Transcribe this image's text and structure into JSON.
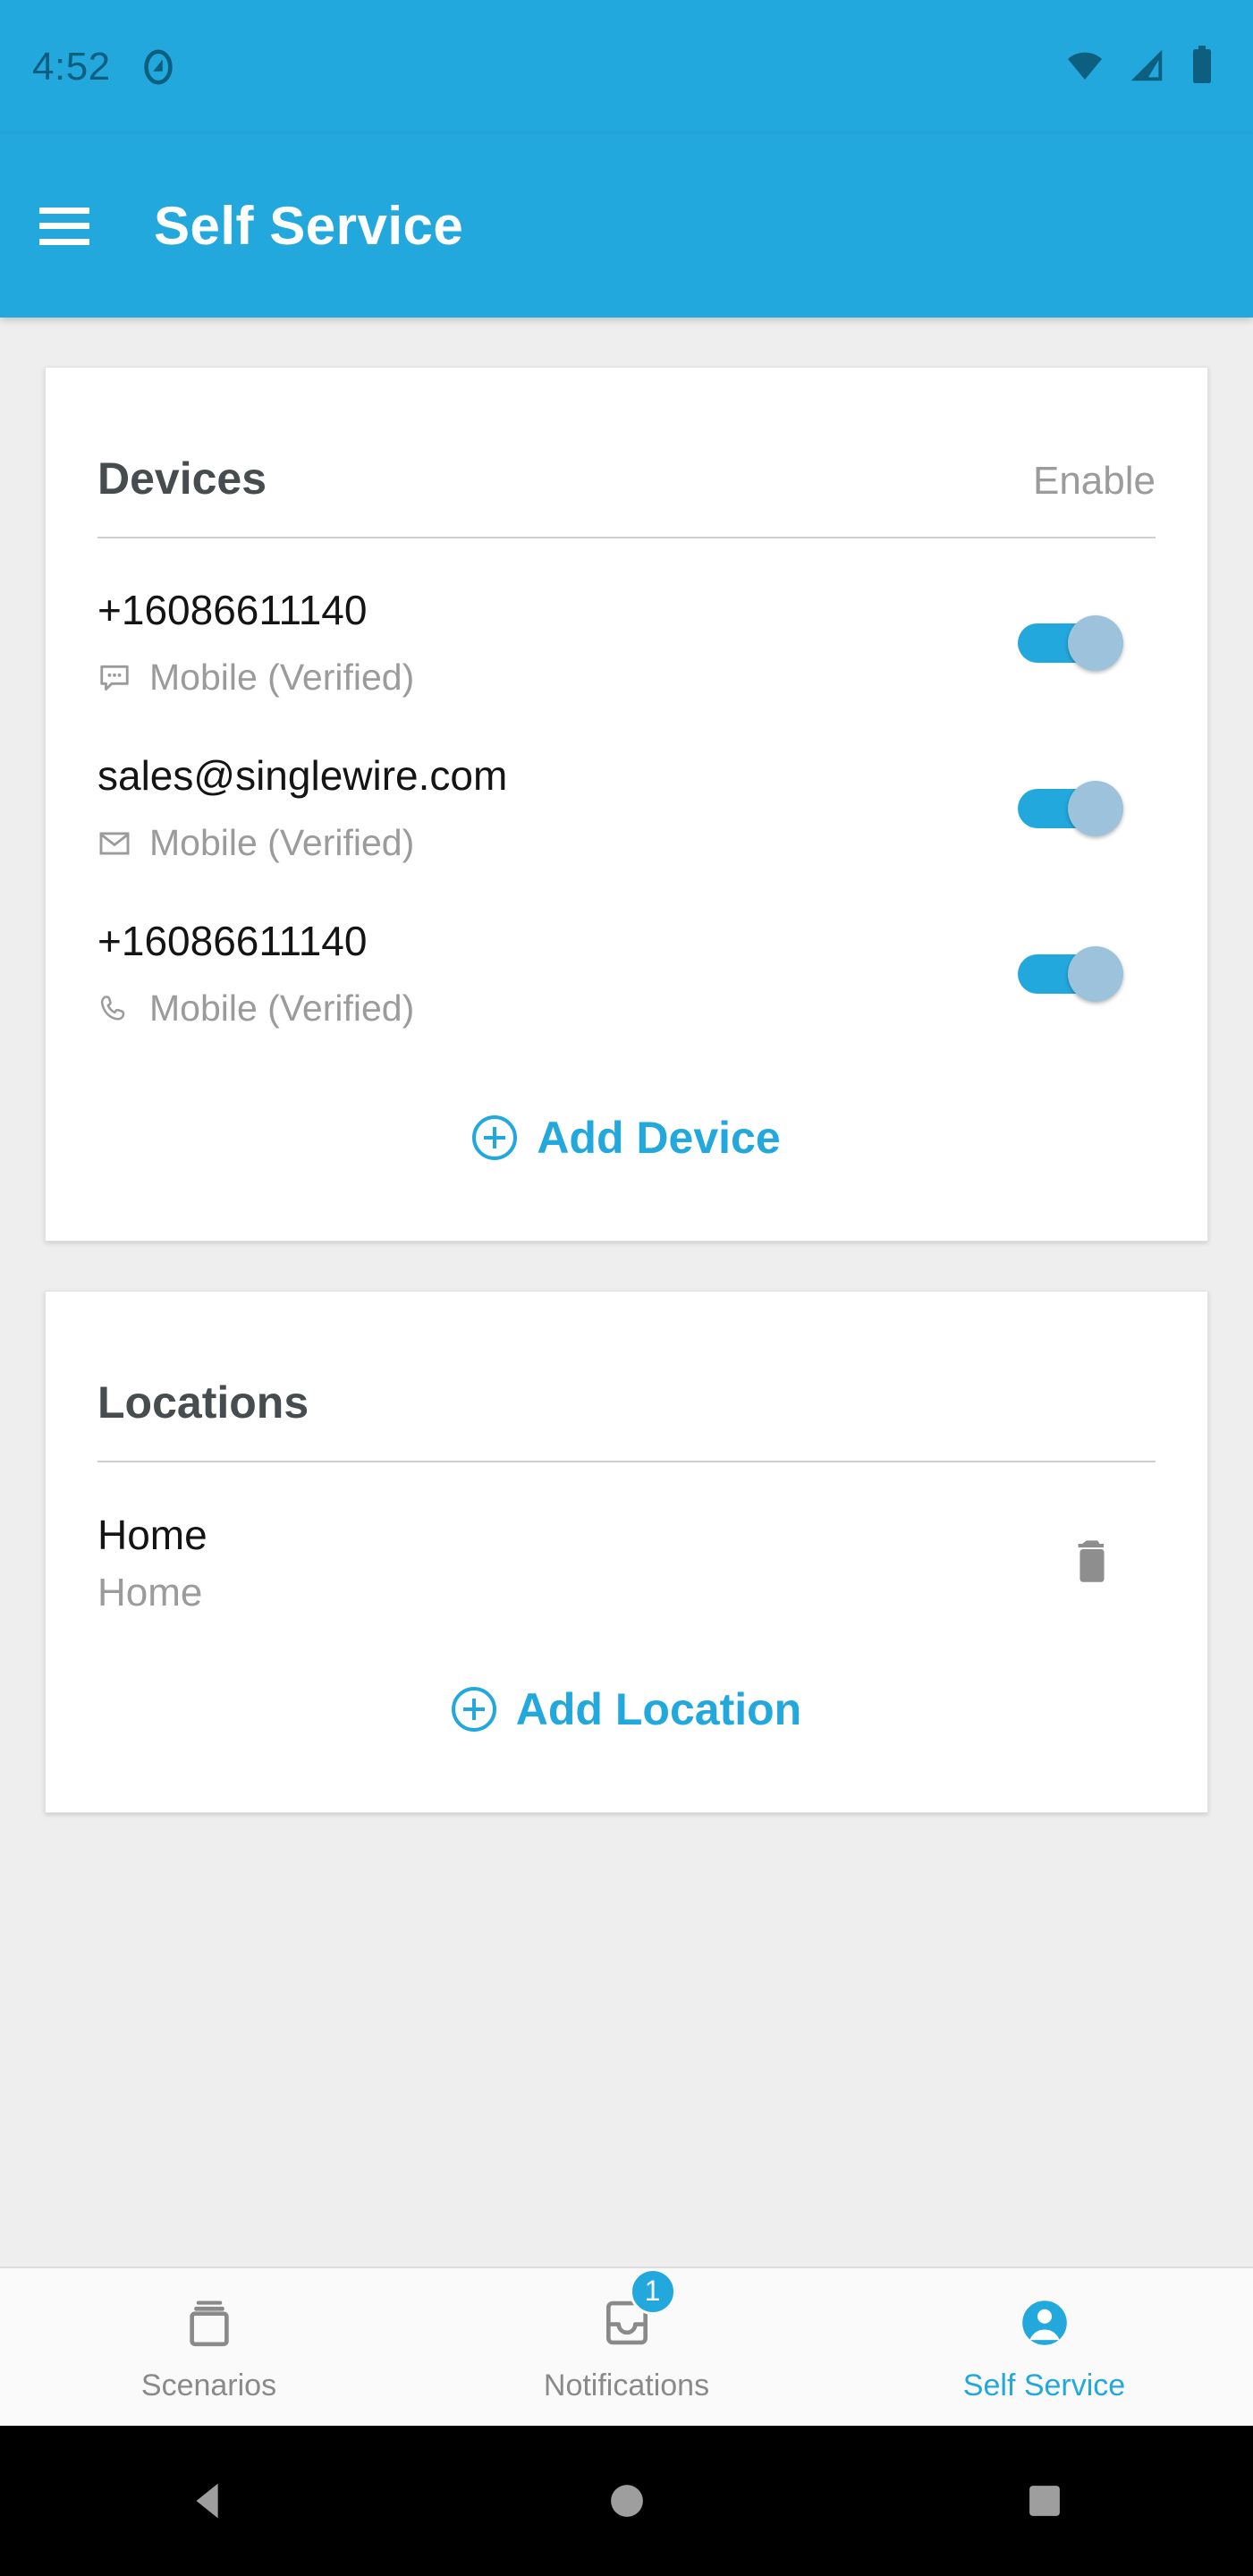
{
  "status_bar": {
    "time": "4:52",
    "icons": [
      "android-q-icon",
      "wifi-icon",
      "cellular-signal-icon",
      "battery-icon"
    ]
  },
  "app_bar": {
    "menu_icon": "hamburger-menu-icon",
    "title": "Self Service"
  },
  "devices_card": {
    "title": "Devices",
    "header_action": "Enable",
    "items": [
      {
        "value": "+16086611140",
        "type_icon": "sms-message-icon",
        "type_label": "Mobile (Verified)",
        "enabled": true
      },
      {
        "value": "sales@singlewire.com",
        "type_icon": "email-envelope-icon",
        "type_label": "Mobile (Verified)",
        "enabled": true
      },
      {
        "value": "+16086611140",
        "type_icon": "phone-handset-icon",
        "type_label": "Mobile (Verified)",
        "enabled": true
      }
    ],
    "add_action": {
      "icon": "plus-circle-icon",
      "label": "Add Device"
    }
  },
  "locations_card": {
    "title": "Locations",
    "items": [
      {
        "name": "Home",
        "description": "Home",
        "delete_icon": "trash-icon"
      }
    ],
    "add_action": {
      "icon": "plus-circle-icon",
      "label": "Add Location"
    }
  },
  "bottom_nav": {
    "items": [
      {
        "label": "Scenarios",
        "icon": "archive-box-icon",
        "active": false,
        "badge": null
      },
      {
        "label": "Notifications",
        "icon": "inbox-icon",
        "active": false,
        "badge": "1"
      },
      {
        "label": "Self Service",
        "icon": "person-icon",
        "active": true,
        "badge": null
      }
    ]
  },
  "system_nav": {
    "back": "back-triangle-icon",
    "home": "home-circle-icon",
    "recents": "recents-square-icon"
  },
  "colors": {
    "brand_blue": "#23a8dd",
    "toggle_thumb": "#9cc3db",
    "page_background": "#eeeeee",
    "card_background": "#ffffff",
    "primary_text": "#141414",
    "secondary_text": "#9b9b9b",
    "title_text": "#474d4f"
  }
}
